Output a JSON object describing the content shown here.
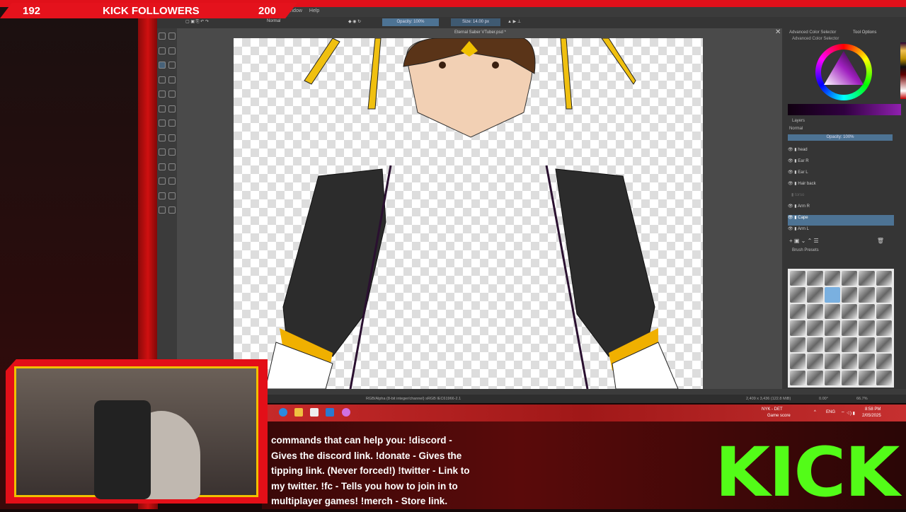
{
  "overlay": {
    "followers_current": "192",
    "followers_label": "KICK FOLLOWERS",
    "followers_goal": "200",
    "kick_logo": "KICK"
  },
  "krita": {
    "menu": [
      "Window",
      "Help"
    ],
    "toolbar": {
      "blend_mode": "Normal",
      "opacity": "Opacity: 100%",
      "size": "Size: 14.00 px"
    },
    "document_title": "Eternal Saber VTuber.psd *",
    "dockers": {
      "tabs": [
        "Advanced Color Selector",
        "Tool Options"
      ],
      "color_selector_title": "Advanced Color Selector",
      "layers_title": "Layers",
      "layers_blend": "Normal",
      "layers_opacity": "Opacity: 100%",
      "brush_presets_title": "Brush Presets"
    },
    "layers": [
      {
        "name": "head",
        "visible": true
      },
      {
        "name": "Ear R",
        "visible": true
      },
      {
        "name": "Ear L",
        "visible": true
      },
      {
        "name": "Hair back",
        "visible": true
      },
      {
        "name": "torso",
        "visible": false
      },
      {
        "name": "Arm R",
        "visible": true
      },
      {
        "name": "Cape",
        "visible": true,
        "selected": true
      },
      {
        "name": "Arm L",
        "visible": true
      }
    ],
    "status": {
      "color_space": "RGB/Alpha (8-bit integer/channel)  sRGB IEC61966-2.1",
      "dimensions": "2,409 x 3,436 (122.8 MiB)",
      "rotation": "0.00°",
      "zoom": "66.7%"
    }
  },
  "taskbar": {
    "weather_title": "NYK - DET",
    "weather_sub": "Game score",
    "lang": "ENG",
    "time": "8:58 PM",
    "date": "2/05/2025"
  },
  "chat": {
    "message": "commands that can help you: !discord - Gives the discord link. !donate - Gives the tipping link. (Never forced!) !twitter - Link to my twitter. !fc - Tells you how to join in to multiplayer games! !merch - Store link."
  }
}
